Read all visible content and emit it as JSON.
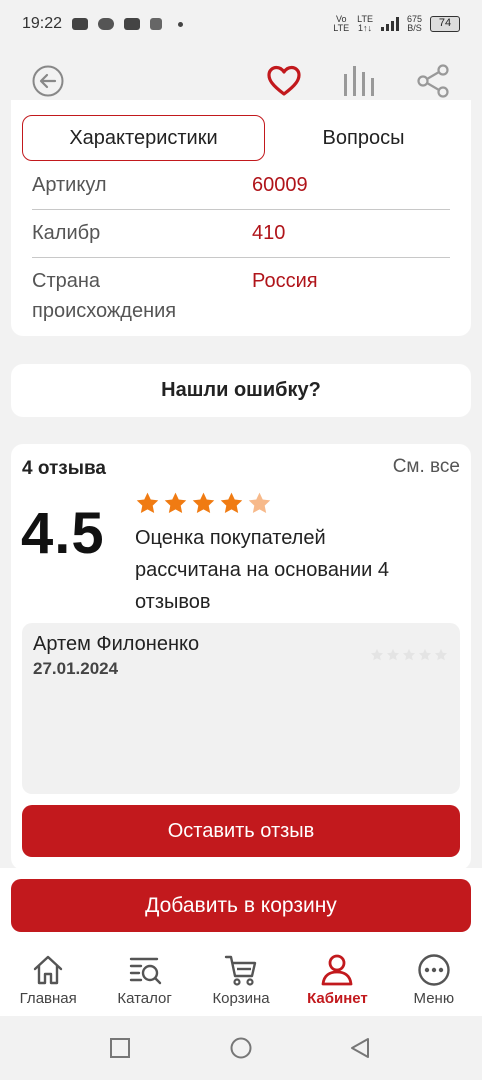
{
  "status_bar": {
    "time": "19:22",
    "net1_top": "Vo",
    "net1_bottom": "LTE",
    "net2_top": "LTE",
    "net2_bottom": "1↑↓",
    "speed_value": "675",
    "speed_unit": "B/S",
    "battery": "74"
  },
  "top_bar": {
    "back_icon": "arrow-left-circle-icon",
    "favorite_icon": "heart-icon",
    "compare_icon": "compare-bars-icon",
    "share_icon": "share-icon",
    "accent_color": "#c2191d"
  },
  "specs": {
    "tabs": [
      {
        "label": "Характеристики",
        "active": true
      },
      {
        "label": "Вопросы",
        "active": false
      }
    ],
    "rows": [
      {
        "label": "Артикул",
        "value": "60009"
      },
      {
        "label": "Калибр",
        "value": "410"
      },
      {
        "label": "Страна происхождения",
        "value": "Россия"
      }
    ]
  },
  "error_report": {
    "label": "Нашли ошибку?"
  },
  "reviews": {
    "count_label": "4 отзыва",
    "see_all": "См. все",
    "rating": "4.5",
    "stars_value": 4.5,
    "stars_max": 5,
    "description": "Оценка покупателей рассчитана на основании 4 отзывов",
    "items": [
      {
        "author": "Артем Филоненко",
        "date": "27.01.2024",
        "stars": 0
      }
    ],
    "leave_review": "Оставить отзыв"
  },
  "cart": {
    "add_to_cart": "Добавить в корзину"
  },
  "bottom_nav": {
    "items": [
      {
        "label": "Главная",
        "icon": "home-icon",
        "active": false
      },
      {
        "label": "Каталог",
        "icon": "catalog-search-icon",
        "active": false
      },
      {
        "label": "Корзина",
        "icon": "cart-icon",
        "active": false
      },
      {
        "label": "Кабинет",
        "icon": "user-icon",
        "active": true
      },
      {
        "label": "Меню",
        "icon": "menu-dots-icon",
        "active": false
      }
    ]
  },
  "system_nav": {
    "recent_icon": "square-icon",
    "home_icon": "circle-icon",
    "back_icon": "triangle-back-icon"
  },
  "colors": {
    "accent": "#c2191d",
    "star_full": "#f07b12",
    "star_half_light": "#f7b98a",
    "page_bg": "#f2f2f2"
  }
}
